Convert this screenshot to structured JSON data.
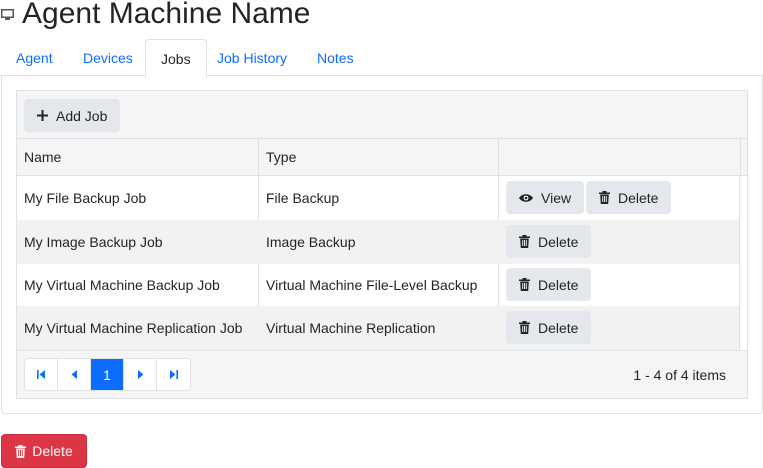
{
  "page": {
    "title": "Agent Machine Name"
  },
  "tabs": [
    {
      "label": "Agent"
    },
    {
      "label": "Devices"
    },
    {
      "label": "Jobs"
    },
    {
      "label": "Job History"
    },
    {
      "label": "Notes"
    }
  ],
  "active_tab": "Jobs",
  "toolbar": {
    "add_job_label": "Add Job"
  },
  "table": {
    "columns": [
      "Name",
      "Type"
    ],
    "rows": [
      {
        "name": "My File Backup Job",
        "type": "File Backup",
        "actions": [
          "View",
          "Delete"
        ]
      },
      {
        "name": "My Image Backup Job",
        "type": "Image Backup",
        "actions": [
          "Delete"
        ]
      },
      {
        "name": "My Virtual Machine Backup Job",
        "type": "Virtual Machine File-Level Backup",
        "actions": [
          "Delete"
        ]
      },
      {
        "name": "My Virtual Machine Replication Job",
        "type": "Virtual Machine Replication",
        "actions": [
          "Delete"
        ]
      }
    ]
  },
  "pager": {
    "current_page": "1",
    "info": "1 - 4 of 4 items"
  },
  "footer": {
    "delete_label": "Delete"
  },
  "colors": {
    "accent": "#0d6efd",
    "danger": "#dc3545",
    "button_bg": "#e4e7eb"
  }
}
